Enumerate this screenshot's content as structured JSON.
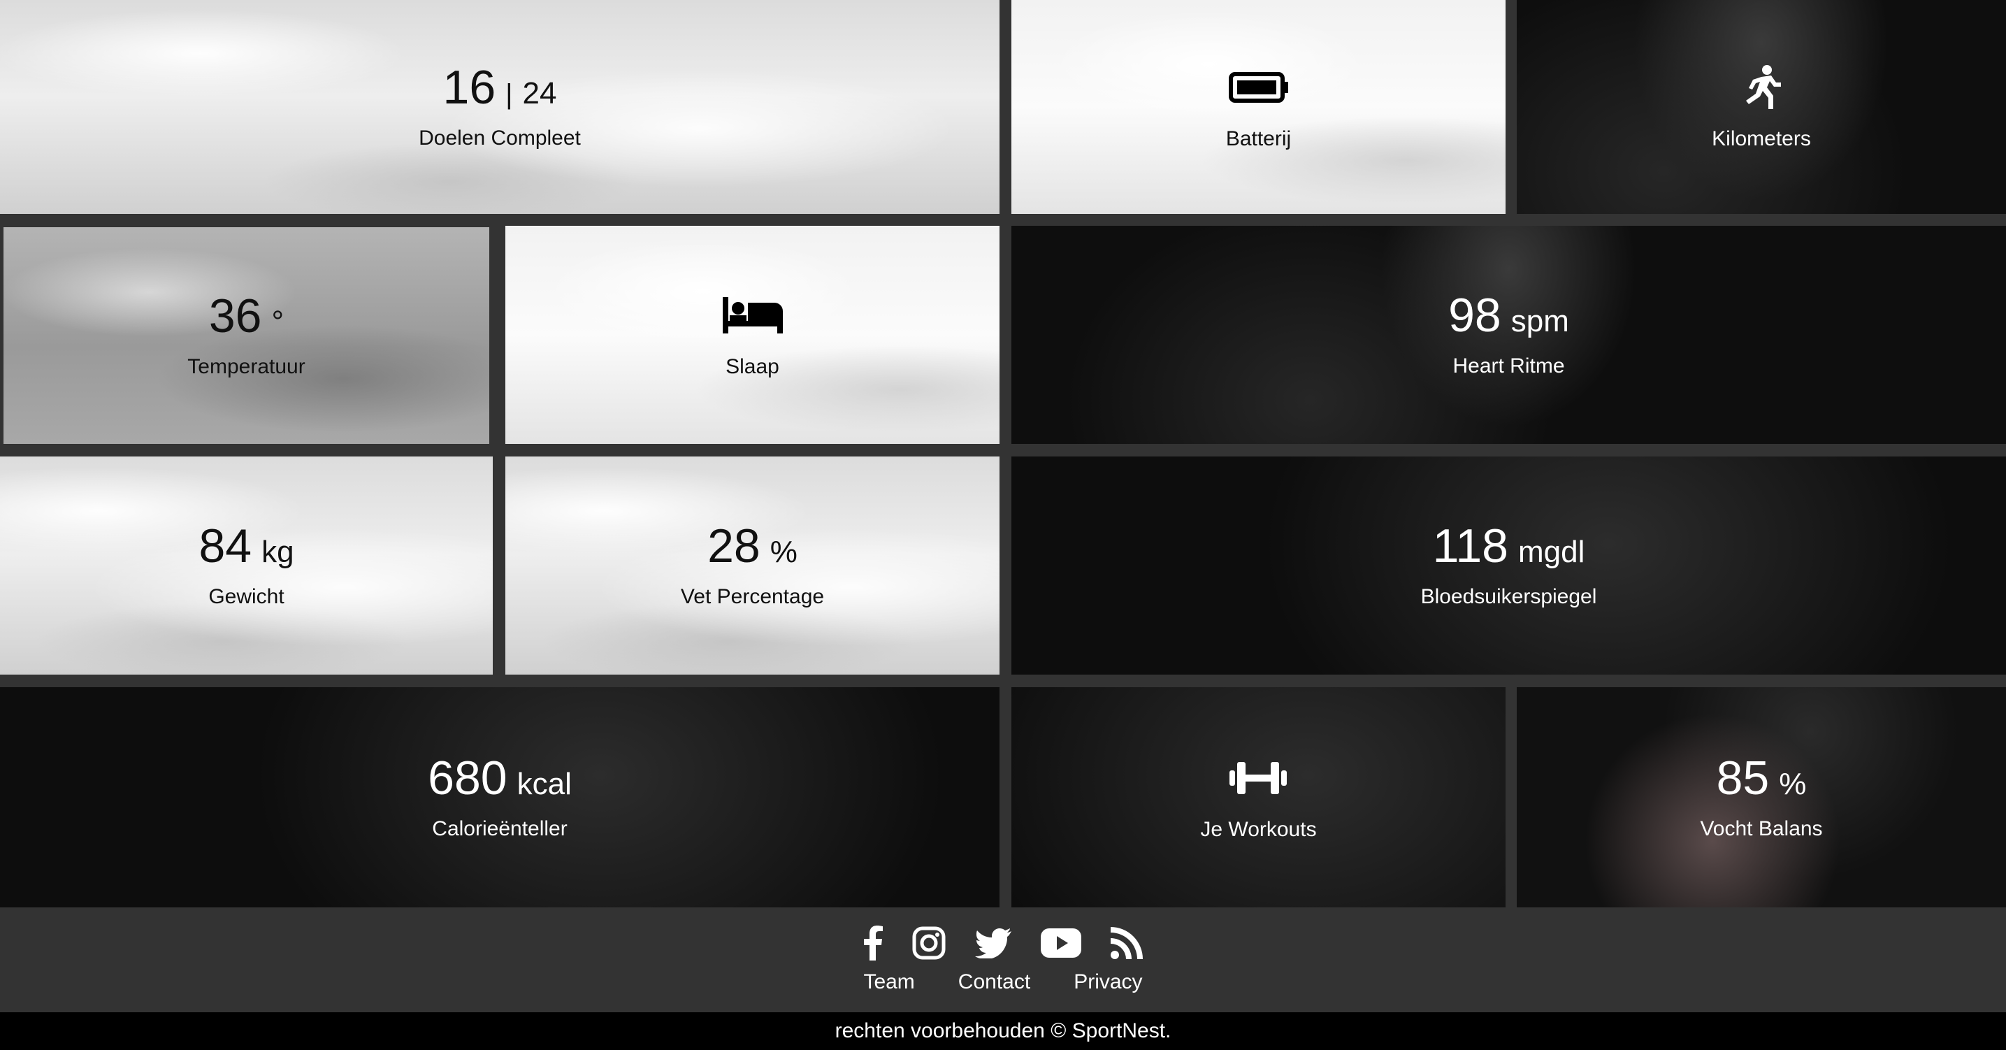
{
  "tiles": {
    "goals": {
      "value": "16",
      "separator": "|",
      "total": "24",
      "label": "Doelen Compleet"
    },
    "battery": {
      "label": "Batterij",
      "icon": "battery-icon"
    },
    "kilometers": {
      "label": "Kilometers",
      "icon": "running-icon"
    },
    "temperature": {
      "value": "36",
      "unit": "°",
      "label": "Temperatuur"
    },
    "sleep": {
      "label": "Slaap",
      "icon": "bed-icon"
    },
    "heart": {
      "value": "98",
      "unit": "spm",
      "label": "Heart Ritme"
    },
    "weight": {
      "value": "84",
      "unit": "kg",
      "label": "Gewicht"
    },
    "fat": {
      "value": "28",
      "unit": "%",
      "label": "Vet Percentage"
    },
    "glucose": {
      "value": "118",
      "unit": "mgdl",
      "label": "Bloedsuikerspiegel"
    },
    "calories": {
      "value": "680",
      "unit": "kcal",
      "label": "Calorieënteller"
    },
    "workouts": {
      "label": "Je Workouts",
      "icon": "dumbbell-icon"
    },
    "hydration": {
      "value": "85",
      "unit": "%",
      "label": "Vocht Balans"
    }
  },
  "footer": {
    "social_icons": [
      "facebook-icon",
      "instagram-icon",
      "twitter-icon",
      "youtube-icon",
      "rss-icon"
    ],
    "links": {
      "team": "Team",
      "contact": "Contact",
      "privacy": "Privacy"
    },
    "copyright": "rechten voorbehouden © SportNest."
  }
}
